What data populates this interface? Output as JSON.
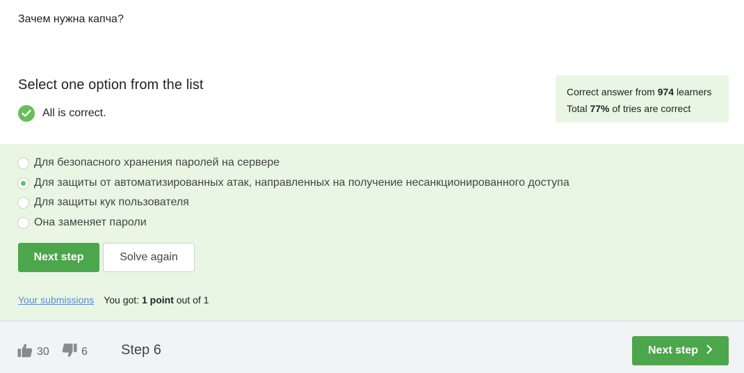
{
  "question": {
    "text": "Зачем нужна капча?"
  },
  "instruction": {
    "text": "Select one option from the list"
  },
  "status": {
    "text": "All is correct."
  },
  "stats": {
    "line1_prefix": "Correct answer from ",
    "line1_count": "974",
    "line1_suffix": " learners",
    "line2_prefix": "Total ",
    "line2_percent": "77%",
    "line2_suffix": " of tries are correct"
  },
  "options": [
    {
      "label": "Для безопасного хранения паролей на сервере",
      "selected": false
    },
    {
      "label": "Для защиты от автоматизированных атак, направленных на получение несанкционированного доступа",
      "selected": true
    },
    {
      "label": "Для защиты кук пользователя",
      "selected": false
    },
    {
      "label": "Она заменяет пароли",
      "selected": false
    }
  ],
  "buttons": {
    "next_step": "Next step",
    "solve_again": "Solve again"
  },
  "submissions": {
    "link": "Your submissions",
    "got_prefix": "You got: ",
    "got_points": "1 point",
    "got_suffix": " out of 1"
  },
  "footer": {
    "likes": "30",
    "dislikes": "6",
    "step": "Step 6",
    "next_step": "Next step"
  },
  "colors": {
    "accent": "#4ca64b",
    "panel": "#e9f6e3",
    "link": "#5a8ad6"
  }
}
